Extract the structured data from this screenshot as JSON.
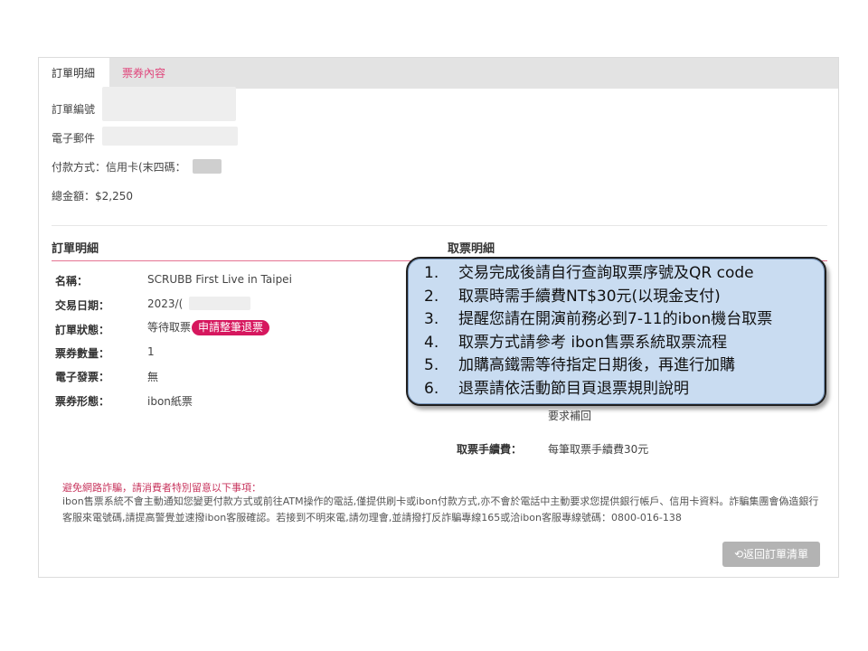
{
  "tabs": {
    "order_detail": "訂單明細",
    "ticket_content": "票券內容"
  },
  "summary": {
    "order_no_label": "訂單編號",
    "email_label": "電子郵件",
    "payment_label": "付款方式：信用卡(末四碼：",
    "total_label": "總金額：$2,250"
  },
  "order_section": {
    "title": "訂單明細",
    "rows": [
      {
        "label": "名稱：",
        "value": "SCRUBB First Live in Taipei"
      },
      {
        "label": "交易日期：",
        "value": "2023/("
      },
      {
        "label": "訂單狀態：",
        "value": "等待取票",
        "badge": "申請整筆退票"
      },
      {
        "label": "票券數量：",
        "value": "1"
      },
      {
        "label": "電子發票：",
        "value": "無"
      },
      {
        "label": "票券形態：",
        "value": "ibon紙票"
      }
    ]
  },
  "pickup_section": {
    "title": "取票明細",
    "partial_text": "要求補回",
    "fee_label": "取票手續費：",
    "fee_value": "每筆取票手續費30元"
  },
  "warning": {
    "title": "避免網路詐騙，請消費者特別留意以下事項：",
    "text": "ibon售票系統不會主動通知您變更付款方式或前往ATM操作的電話,僅提供刷卡或ibon付款方式,亦不會於電話中主動要求您提供銀行帳戶、信用卡資料。詐騙集團會偽造銀行客服來電號碼,請提高警覺並速撥ibon客服確認。若接到不明來電,請勿理會,並請撥打反詐騙專線165或洽ibon客服專線號碼：0800-016-138"
  },
  "back_button": {
    "icon": "undo-icon",
    "label": "返回訂單清單"
  },
  "overlay": {
    "items": [
      {
        "num": "1.",
        "text": "交易完成後請自行查詢取票序號及QR code"
      },
      {
        "num": "2.",
        "text": "取票時需手續費NT$30元(以現金支付)"
      },
      {
        "num": "3.",
        "text": "提醒您請在開演前務必到7-11的ibon機台取票"
      },
      {
        "num": "4.",
        "text": "取票方式請參考 ibon售票系統取票流程"
      },
      {
        "num": "5.",
        "text": "加購高鐵需等待指定日期後，再進行加購"
      },
      {
        "num": "6.",
        "text": "退票請依活動節目頁退票規則說明"
      }
    ]
  },
  "colors": {
    "accent": "#d6175e",
    "tab_inactive": "#e0457b",
    "overlay_bg": "#c9dcf1"
  }
}
